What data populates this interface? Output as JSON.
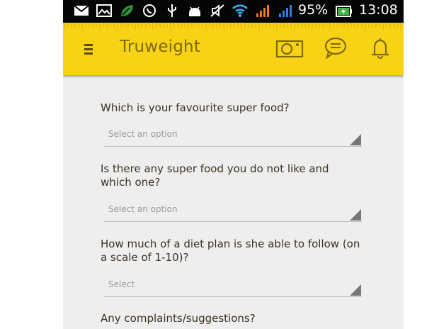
{
  "status_bar": {
    "icons": [
      "gmail-icon",
      "image-icon",
      "leaf-icon",
      "whatsapp-icon",
      "usb-icon",
      "android-icon",
      "mute-icon",
      "wifi-icon",
      "signal-icon-1",
      "signal-icon-2"
    ],
    "battery_text": "95%",
    "time": "13:08"
  },
  "toolbar": {
    "title": "Truweight",
    "icons": [
      "menu-icon",
      "camera-icon",
      "chat-icon",
      "bell-icon"
    ],
    "accent_color": "#f7d215",
    "icon_color": "#7d6a08"
  },
  "form": {
    "questions": [
      {
        "label": "Which is your favourite super food?",
        "placeholder": "Select an option"
      },
      {
        "label": "Is there any super food you do not like and which one?",
        "placeholder": "Select an option"
      },
      {
        "label": "How much of a diet plan is she able to follow (on a scale of 1-10)?",
        "placeholder": "Select"
      },
      {
        "label": "Any complaints/suggestions?"
      }
    ]
  }
}
